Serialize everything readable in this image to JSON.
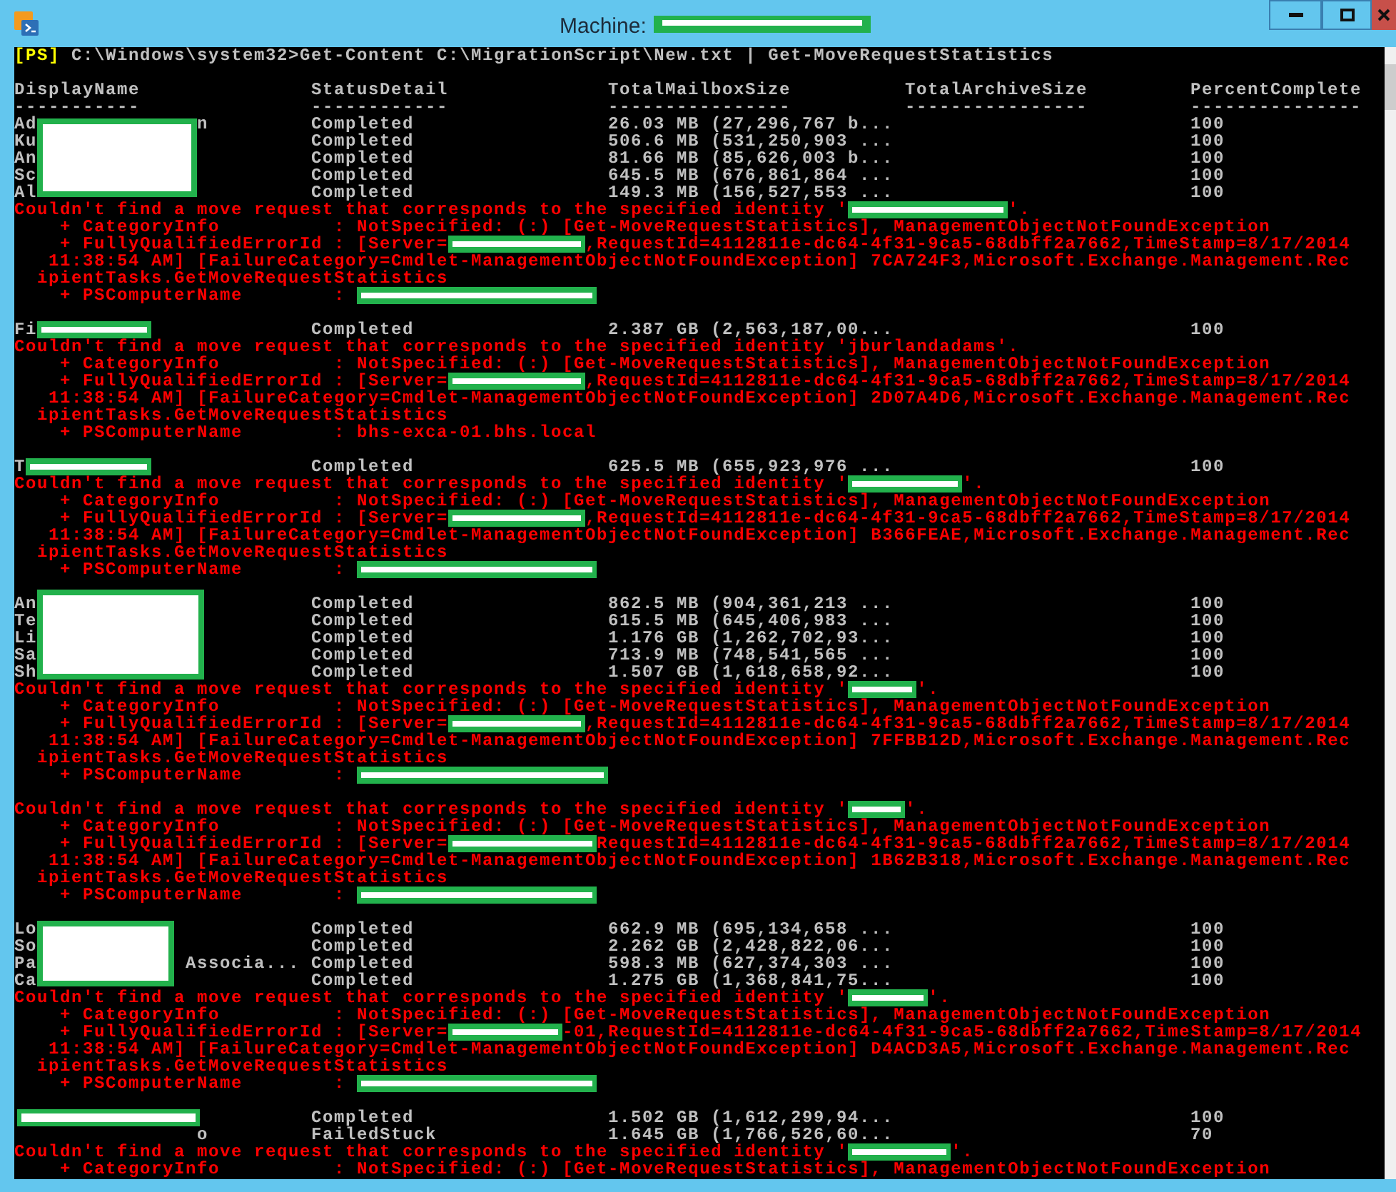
{
  "window": {
    "title": "Machine:",
    "title_redacted": true
  },
  "console": {
    "lines": [
      {
        "kind": "prompt",
        "segments": [
          {
            "kind": "tag",
            "text": "[PS]"
          },
          {
            "text": " C:\\Windows\\system32>Get-Content C:\\MigrationScript\\New.txt | Get-MoveRequestStatistics"
          }
        ]
      },
      {
        "kind": "blank"
      },
      {
        "kind": "header",
        "cells": [
          "DisplayName",
          "StatusDetail",
          "TotalMailboxSize",
          "TotalArchiveSize",
          "PercentComplete"
        ]
      },
      {
        "kind": "rule",
        "cells": [
          "-----------",
          "------------",
          "----------------",
          "----------------",
          "---------------"
        ]
      },
      {
        "kind": "row",
        "name": [
          {
            "text": "Ad"
          },
          {
            "kind": "block"
          },
          {
            "text": "              n"
          }
        ],
        "cells": [
          "Completed",
          "26.03 MB (27,296,767 b...",
          "100"
        ]
      },
      {
        "kind": "row",
        "name": [
          {
            "text": "Ku"
          }
        ],
        "cells": [
          "Completed",
          "506.6 MB (531,250,903 ...",
          "100"
        ]
      },
      {
        "kind": "row",
        "name": [
          {
            "text": "An"
          }
        ],
        "cells": [
          "Completed",
          "81.66 MB (85,626,003 b...",
          "100"
        ]
      },
      {
        "kind": "row",
        "name": [
          {
            "text": "Sc"
          }
        ],
        "cells": [
          "Completed",
          "645.5 MB (676,861,864 ...",
          "100"
        ]
      },
      {
        "kind": "row",
        "name": [
          {
            "text": "Al"
          }
        ],
        "cells": [
          "Completed",
          "149.3 MB (156,527,553 ...",
          "100"
        ]
      },
      {
        "kind": "error",
        "segments": [
          {
            "text": "Couldn't find a move request that corresponds to the specified identity '"
          },
          {
            "kind": "bar"
          },
          {
            "text": "'."
          }
        ]
      },
      {
        "kind": "error",
        "segments": [
          {
            "text": "    + CategoryInfo          : NotSpecified: (:) [Get-MoveRequestStatistics], ManagementObjectNotFoundException"
          }
        ]
      },
      {
        "kind": "error",
        "segments": [
          {
            "text": "    + FullyQualifiedErrorId : [Server="
          },
          {
            "kind": "bar"
          },
          {
            "text": ",RequestId=4112811e-dc64-4f31-9ca5-68dbff2a7662,TimeStamp=8/17/2014"
          }
        ]
      },
      {
        "kind": "error",
        "segments": [
          {
            "text": "   11:38:54 AM] [FailureCategory=Cmdlet-ManagementObjectNotFoundException] 7CA724F3,Microsoft.Exchange.Management.Rec"
          }
        ]
      },
      {
        "kind": "error",
        "segments": [
          {
            "text": "  ipientTasks.GetMoveRequestStatistics"
          }
        ]
      },
      {
        "kind": "error",
        "segments": [
          {
            "text": "    + PSComputerName        : "
          },
          {
            "kind": "bar"
          }
        ]
      },
      {
        "kind": "blank"
      },
      {
        "kind": "row",
        "name": [
          {
            "text": "Fi"
          },
          {
            "kind": "bar"
          }
        ],
        "cells": [
          "Completed",
          "2.387 GB (2,563,187,00...",
          "100"
        ]
      },
      {
        "kind": "error",
        "segments": [
          {
            "text": "Couldn't find a move request that corresponds to the specified identity 'jburlandadams'."
          }
        ]
      },
      {
        "kind": "error",
        "segments": [
          {
            "text": "    + CategoryInfo          : NotSpecified: (:) [Get-MoveRequestStatistics], ManagementObjectNotFoundException"
          }
        ]
      },
      {
        "kind": "error",
        "segments": [
          {
            "text": "    + FullyQualifiedErrorId : [Server="
          },
          {
            "kind": "bar"
          },
          {
            "text": ",RequestId=4112811e-dc64-4f31-9ca5-68dbff2a7662,TimeStamp=8/17/2014"
          }
        ]
      },
      {
        "kind": "error",
        "segments": [
          {
            "text": "   11:38:54 AM] [FailureCategory=Cmdlet-ManagementObjectNotFoundException] 2D07A4D6,Microsoft.Exchange.Management.Rec"
          }
        ]
      },
      {
        "kind": "error",
        "segments": [
          {
            "text": "  ipientTasks.GetMoveRequestStatistics"
          }
        ]
      },
      {
        "kind": "error",
        "segments": [
          {
            "text": "    + PSComputerName        : bhs-exca-01.bhs.local"
          }
        ]
      },
      {
        "kind": "blank"
      },
      {
        "kind": "row",
        "name": [
          {
            "text": "T"
          },
          {
            "kind": "bar"
          }
        ],
        "cells": [
          "Completed",
          "625.5 MB (655,923,976 ...",
          "100"
        ]
      },
      {
        "kind": "error",
        "segments": [
          {
            "text": "Couldn't find a move request that corresponds to the specified identity '"
          },
          {
            "kind": "bar"
          },
          {
            "text": "'."
          }
        ]
      },
      {
        "kind": "error",
        "segments": [
          {
            "text": "    + CategoryInfo          : NotSpecified: (:) [Get-MoveRequestStatistics], ManagementObjectNotFoundException"
          }
        ]
      },
      {
        "kind": "error",
        "segments": [
          {
            "text": "    + FullyQualifiedErrorId : [Server="
          },
          {
            "kind": "bar"
          },
          {
            "text": ",RequestId=4112811e-dc64-4f31-9ca5-68dbff2a7662,TimeStamp=8/17/2014"
          }
        ]
      },
      {
        "kind": "error",
        "segments": [
          {
            "text": "   11:38:54 AM] [FailureCategory=Cmdlet-ManagementObjectNotFoundException] B366FEAE,Microsoft.Exchange.Management.Rec"
          }
        ]
      },
      {
        "kind": "error",
        "segments": [
          {
            "text": "  ipientTasks.GetMoveRequestStatistics"
          }
        ]
      },
      {
        "kind": "error",
        "segments": [
          {
            "text": "    + PSComputerName        : "
          },
          {
            "kind": "bar"
          }
        ]
      },
      {
        "kind": "blank"
      },
      {
        "kind": "row",
        "name": [
          {
            "text": "An"
          },
          {
            "kind": "block"
          }
        ],
        "cells": [
          "Completed",
          "862.5 MB (904,361,213 ...",
          "100"
        ]
      },
      {
        "kind": "row",
        "name": [
          {
            "text": "Te"
          }
        ],
        "cells": [
          "Completed",
          "615.5 MB (645,406,983 ...",
          "100"
        ]
      },
      {
        "kind": "row",
        "name": [
          {
            "text": "Li"
          }
        ],
        "cells": [
          "Completed",
          "1.176 GB (1,262,702,93...",
          "100"
        ]
      },
      {
        "kind": "row",
        "name": [
          {
            "text": "Sa"
          }
        ],
        "cells": [
          "Completed",
          "713.9 MB (748,541,565 ...",
          "100"
        ]
      },
      {
        "kind": "row",
        "name": [
          {
            "text": "Sh"
          }
        ],
        "cells": [
          "Completed",
          "1.507 GB (1,618,658,92...",
          "100"
        ]
      },
      {
        "kind": "error",
        "segments": [
          {
            "text": "Couldn't find a move request that corresponds to the specified identity '"
          },
          {
            "kind": "bar"
          },
          {
            "text": "'."
          }
        ]
      },
      {
        "kind": "error",
        "segments": [
          {
            "text": "    + CategoryInfo          : NotSpecified: (:) [Get-MoveRequestStatistics], ManagementObjectNotFoundException"
          }
        ]
      },
      {
        "kind": "error",
        "segments": [
          {
            "text": "    + FullyQualifiedErrorId : [Server="
          },
          {
            "kind": "bar"
          },
          {
            "text": ",RequestId=4112811e-dc64-4f31-9ca5-68dbff2a7662,TimeStamp=8/17/2014"
          }
        ]
      },
      {
        "kind": "error",
        "segments": [
          {
            "text": "   11:38:54 AM] [FailureCategory=Cmdlet-ManagementObjectNotFoundException] 7FFBB12D,Microsoft.Exchange.Management.Rec"
          }
        ]
      },
      {
        "kind": "error",
        "segments": [
          {
            "text": "  ipientTasks.GetMoveRequestStatistics"
          }
        ]
      },
      {
        "kind": "error",
        "segments": [
          {
            "text": "    + PSComputerName        : "
          },
          {
            "kind": "bar"
          }
        ]
      },
      {
        "kind": "blank"
      },
      {
        "kind": "error",
        "segments": [
          {
            "text": "Couldn't find a move request that corresponds to the specified identity '"
          },
          {
            "kind": "bar"
          },
          {
            "text": "'."
          }
        ]
      },
      {
        "kind": "error",
        "segments": [
          {
            "text": "    + CategoryInfo          : NotSpecified: (:) [Get-MoveRequestStatistics], ManagementObjectNotFoundException"
          }
        ]
      },
      {
        "kind": "error",
        "segments": [
          {
            "text": "    + FullyQualifiedErrorId : [Server="
          },
          {
            "kind": "bar"
          },
          {
            "text": "RequestId=4112811e-dc64-4f31-9ca5-68dbff2a7662,TimeStamp=8/17/2014"
          }
        ]
      },
      {
        "kind": "error",
        "segments": [
          {
            "text": "   11:38:54 AM] [FailureCategory=Cmdlet-ManagementObjectNotFoundException] 1B62B318,Microsoft.Exchange.Management.Rec"
          }
        ]
      },
      {
        "kind": "error",
        "segments": [
          {
            "text": "  ipientTasks.GetMoveRequestStatistics"
          }
        ]
      },
      {
        "kind": "error",
        "segments": [
          {
            "text": "    + PSComputerName        : "
          },
          {
            "kind": "bar"
          }
        ]
      },
      {
        "kind": "blank"
      },
      {
        "kind": "row",
        "name": [
          {
            "text": "Lo"
          },
          {
            "kind": "block"
          }
        ],
        "cells": [
          "Completed",
          "662.9 MB (695,134,658 ...",
          "100"
        ]
      },
      {
        "kind": "row",
        "name": [
          {
            "text": "So"
          }
        ],
        "cells": [
          "Completed",
          "2.262 GB (2,428,822,06...",
          "100"
        ]
      },
      {
        "kind": "row",
        "name": [
          {
            "text": "Pa             Associa..."
          }
        ],
        "cells": [
          "Completed",
          "598.3 MB (627,374,303 ...",
          "100"
        ]
      },
      {
        "kind": "row",
        "name": [
          {
            "text": "Ca"
          }
        ],
        "cells": [
          "Completed",
          "1.275 GB (1,368,841,75...",
          "100"
        ]
      },
      {
        "kind": "error",
        "segments": [
          {
            "text": "Couldn't find a move request that corresponds to the specified identity '"
          },
          {
            "kind": "bar"
          },
          {
            "text": "'."
          }
        ]
      },
      {
        "kind": "error",
        "segments": [
          {
            "text": "    + CategoryInfo          : NotSpecified: (:) [Get-MoveRequestStatistics], ManagementObjectNotFoundException"
          }
        ]
      },
      {
        "kind": "error",
        "segments": [
          {
            "text": "    + FullyQualifiedErrorId : [Server="
          },
          {
            "kind": "bar"
          },
          {
            "text": "-01,RequestId=4112811e-dc64-4f31-9ca5-68dbff2a7662,TimeStamp=8/17/2014"
          }
        ]
      },
      {
        "kind": "error",
        "segments": [
          {
            "text": "   11:38:54 AM] [FailureCategory=Cmdlet-ManagementObjectNotFoundException] D4ACD3A5,Microsoft.Exchange.Management.Rec"
          }
        ]
      },
      {
        "kind": "error",
        "segments": [
          {
            "text": "  ipientTasks.GetMoveRequestStatistics"
          }
        ]
      },
      {
        "kind": "error",
        "segments": [
          {
            "text": "    + PSComputerName        : "
          },
          {
            "kind": "bar"
          }
        ]
      },
      {
        "kind": "blank"
      },
      {
        "kind": "row",
        "name": [
          {
            "kind": "block"
          }
        ],
        "cells": [
          "Completed",
          "1.502 GB (1,612,299,94...",
          "100"
        ]
      },
      {
        "kind": "row",
        "name": [
          {
            "text": "                o"
          }
        ],
        "cells": [
          "FailedStuck",
          "1.645 GB (1,766,526,60...",
          "70"
        ]
      },
      {
        "kind": "error",
        "segments": [
          {
            "text": "Couldn't find a move request that corresponds to the specified identity '"
          },
          {
            "kind": "bar"
          },
          {
            "text": "'."
          }
        ]
      },
      {
        "kind": "error",
        "segments": [
          {
            "text": "    + CategoryInfo          : NotSpecified: (:) [Get-MoveRequestStatistics], ManagementObjectNotFoundException"
          }
        ]
      }
    ]
  }
}
